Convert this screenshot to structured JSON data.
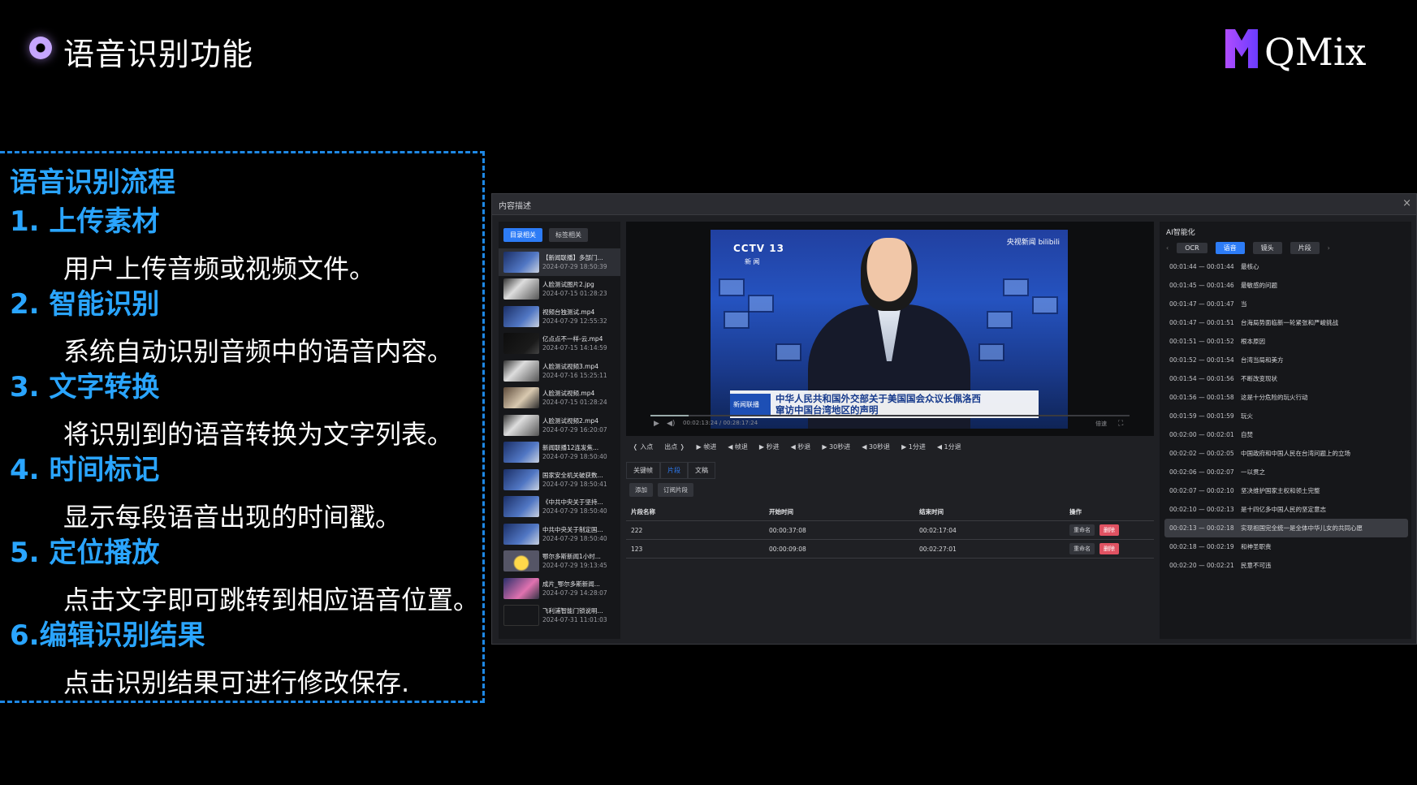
{
  "header": {
    "title": "语音识别功能",
    "logo_text": "QMix"
  },
  "flow": {
    "title": "语音识别流程",
    "steps": [
      {
        "heading": "1. 上传素材",
        "desc": "用户上传音频或视频文件。"
      },
      {
        "heading": "2. 智能识别",
        "desc": "系统自动识别音频中的语音内容。"
      },
      {
        "heading": "3. 文字转换",
        "desc": "将识别到的语音转换为文字列表。"
      },
      {
        "heading": "4. 时间标记",
        "desc": "显示每段语音出现的时间戳。"
      },
      {
        "heading": "5. 定位播放",
        "desc": "点击文字即可跳转到相应语音位置。"
      },
      {
        "heading": "6.编辑识别结果",
        "desc": "点击识别结果可进行修改保存."
      }
    ]
  },
  "app": {
    "window_title": "内容描述",
    "close": "×",
    "file_tabs": [
      "目录相关",
      "标签相关"
    ],
    "files": [
      {
        "name": "【新闻联播】多部门...",
        "date": "2024-07-29 18:50:39",
        "thumb": "news"
      },
      {
        "name": "人脸测试图片2.jpg",
        "date": "2024-07-15 01:28:23",
        "thumb": "face"
      },
      {
        "name": "视频台独测试.mp4",
        "date": "2024-07-29 12:55:32",
        "thumb": "news"
      },
      {
        "name": "亿点点不一样-云.mp4",
        "date": "2024-07-15 14:14:59",
        "thumb": "dark"
      },
      {
        "name": "人脸测试视频3.mp4",
        "date": "2024-07-16 15:25:11",
        "thumb": "face"
      },
      {
        "name": "人脸测试视频.mp4",
        "date": "2024-07-15 01:28:24",
        "thumb": "people"
      },
      {
        "name": "人脸测试视频2.mp4",
        "date": "2024-07-29 16:20:07",
        "thumb": "face"
      },
      {
        "name": "新闻联播12连发焦...",
        "date": "2024-07-29 18:50:40",
        "thumb": "news"
      },
      {
        "name": "国家安全机关破获数...",
        "date": "2024-07-29 18:50:41",
        "thumb": "news"
      },
      {
        "name": "《中共中央关于坚持...",
        "date": "2024-07-29 18:50:40",
        "thumb": "news"
      },
      {
        "name": "中共中央关于制定国...",
        "date": "2024-07-29 18:50:40",
        "thumb": "news"
      },
      {
        "name": "鄂尔多斯新闻1小时...",
        "date": "2024-07-29 19:13:45",
        "thumb": "gold"
      },
      {
        "name": "成片_鄂尔多斯新闻...",
        "date": "2024-07-29 14:28:07",
        "thumb": "pink"
      },
      {
        "name": "飞利浦智能门锁说明...",
        "date": "2024-07-31 11:01:03",
        "thumb": "doc"
      }
    ],
    "video": {
      "channel": "CCTV 13",
      "channel_sub": "新 闻",
      "watermark": "央视新闻 bilibili",
      "caption_logo": "新闻联播",
      "caption_line1": "中华人民共和国外交部关于美国国会众议长佩洛西",
      "caption_line2": "窜访中国台湾地区的声明",
      "time": "00:02:13:24 / 00:28:17:24",
      "speed_label": "倍速",
      "progress": 0.08
    },
    "nav_buttons": [
      "❬ 入点",
      "出点 ❭",
      "▶ 帧进",
      "◀ 帧退",
      "▶ 秒进",
      "◀ 秒退",
      "▶ 30秒进",
      "◀ 30秒退",
      "▶ 1分进",
      "◀ 1分退"
    ],
    "seg_tabs": [
      "关键帧",
      "片段",
      "文稿"
    ],
    "seg_actions": [
      "添加",
      "订阅片段"
    ],
    "seg_table": {
      "headers": [
        "片段名称",
        "开始时间",
        "结束时间",
        "操作"
      ],
      "rows": [
        {
          "name": "222",
          "start": "00:00:37:08",
          "end": "00:02:17:04"
        },
        {
          "name": "123",
          "start": "00:00:09:08",
          "end": "00:02:27:01"
        }
      ],
      "rename": "重命名",
      "delete": "删除"
    },
    "ai": {
      "title": "AI智能化",
      "tabs": [
        "OCR",
        "语音",
        "镜头",
        "片段"
      ],
      "prev": "‹",
      "next": "›",
      "transcript": [
        {
          "time": "00:01:44 — 00:01:44",
          "text": "最核心"
        },
        {
          "time": "00:01:45 — 00:01:46",
          "text": "最敏感的问题"
        },
        {
          "time": "00:01:47 — 00:01:47",
          "text": "当"
        },
        {
          "time": "00:01:47 — 00:01:51",
          "text": "台海局势面临新一轮紧张和严峻挑战"
        },
        {
          "time": "00:01:51 — 00:01:52",
          "text": "根本原因"
        },
        {
          "time": "00:01:52 — 00:01:54",
          "text": "台湾当局和美方"
        },
        {
          "time": "00:01:54 — 00:01:56",
          "text": "不断改变现状"
        },
        {
          "time": "00:01:56 — 00:01:58",
          "text": "这是十分危险的玩火行动"
        },
        {
          "time": "00:01:59 — 00:01:59",
          "text": "玩火"
        },
        {
          "time": "00:02:00 — 00:02:01",
          "text": "自焚"
        },
        {
          "time": "00:02:02 — 00:02:05",
          "text": "中国政府和中国人民在台湾问题上的立场"
        },
        {
          "time": "00:02:06 — 00:02:07",
          "text": "一以贯之"
        },
        {
          "time": "00:02:07 — 00:02:10",
          "text": "坚决维护国家主权和领土完整"
        },
        {
          "time": "00:02:10 — 00:02:13",
          "text": "是十四亿多中国人民的坚定意志"
        },
        {
          "time": "00:02:13 — 00:02:18",
          "text": "实现祖国完全统一是全体中华儿女的共同心愿"
        },
        {
          "time": "00:02:18 — 00:02:19",
          "text": "和神圣职责"
        },
        {
          "time": "00:02:20 — 00:02:21",
          "text": "民意不可违"
        }
      ],
      "active_index": 14
    }
  },
  "colors": {
    "accent": "#2aa5ff",
    "tab_active": "#2d7cf6",
    "danger": "#e05262"
  }
}
